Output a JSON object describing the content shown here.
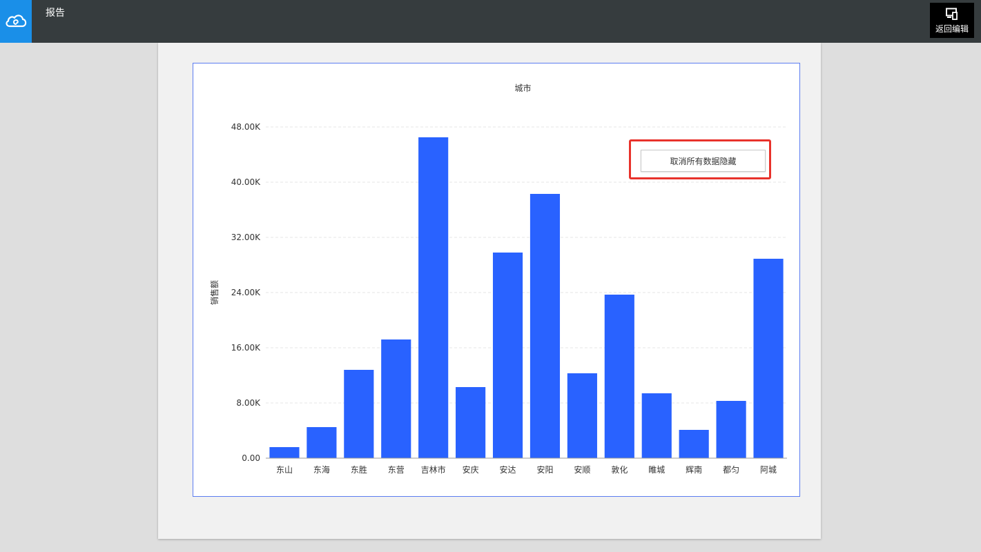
{
  "header": {
    "title": "报告",
    "back_label": "返回编辑",
    "logo_icon": "cloud-icon",
    "back_icon": "device-icon"
  },
  "colors": {
    "topbar": "#363c3e",
    "logo_bg": "#1a8fe8",
    "bar": "#2962ff",
    "highlight": "#e8322b"
  },
  "context_menu": {
    "cancel_label": "取消所有数据隐藏"
  },
  "chart_data": {
    "type": "bar",
    "title": "城市",
    "xlabel": "",
    "ylabel": "销售额",
    "categories": [
      "东山",
      "东海",
      "东胜",
      "东营",
      "吉林市",
      "安庆",
      "安达",
      "安阳",
      "安顺",
      "敦化",
      "睢城",
      "辉南",
      "都匀",
      "阿城"
    ],
    "values": [
      1600,
      4500,
      12800,
      17200,
      46500,
      10300,
      29800,
      38300,
      12300,
      23700,
      9400,
      4100,
      8300,
      28900
    ],
    "ylim": [
      0,
      48000
    ],
    "yticks": [
      0,
      8000,
      16000,
      24000,
      32000,
      40000,
      48000
    ],
    "ytick_labels": [
      "0.00",
      "8.00K",
      "16.00K",
      "24.00K",
      "32.00K",
      "40.00K",
      "48.00K"
    ],
    "grid": true
  }
}
